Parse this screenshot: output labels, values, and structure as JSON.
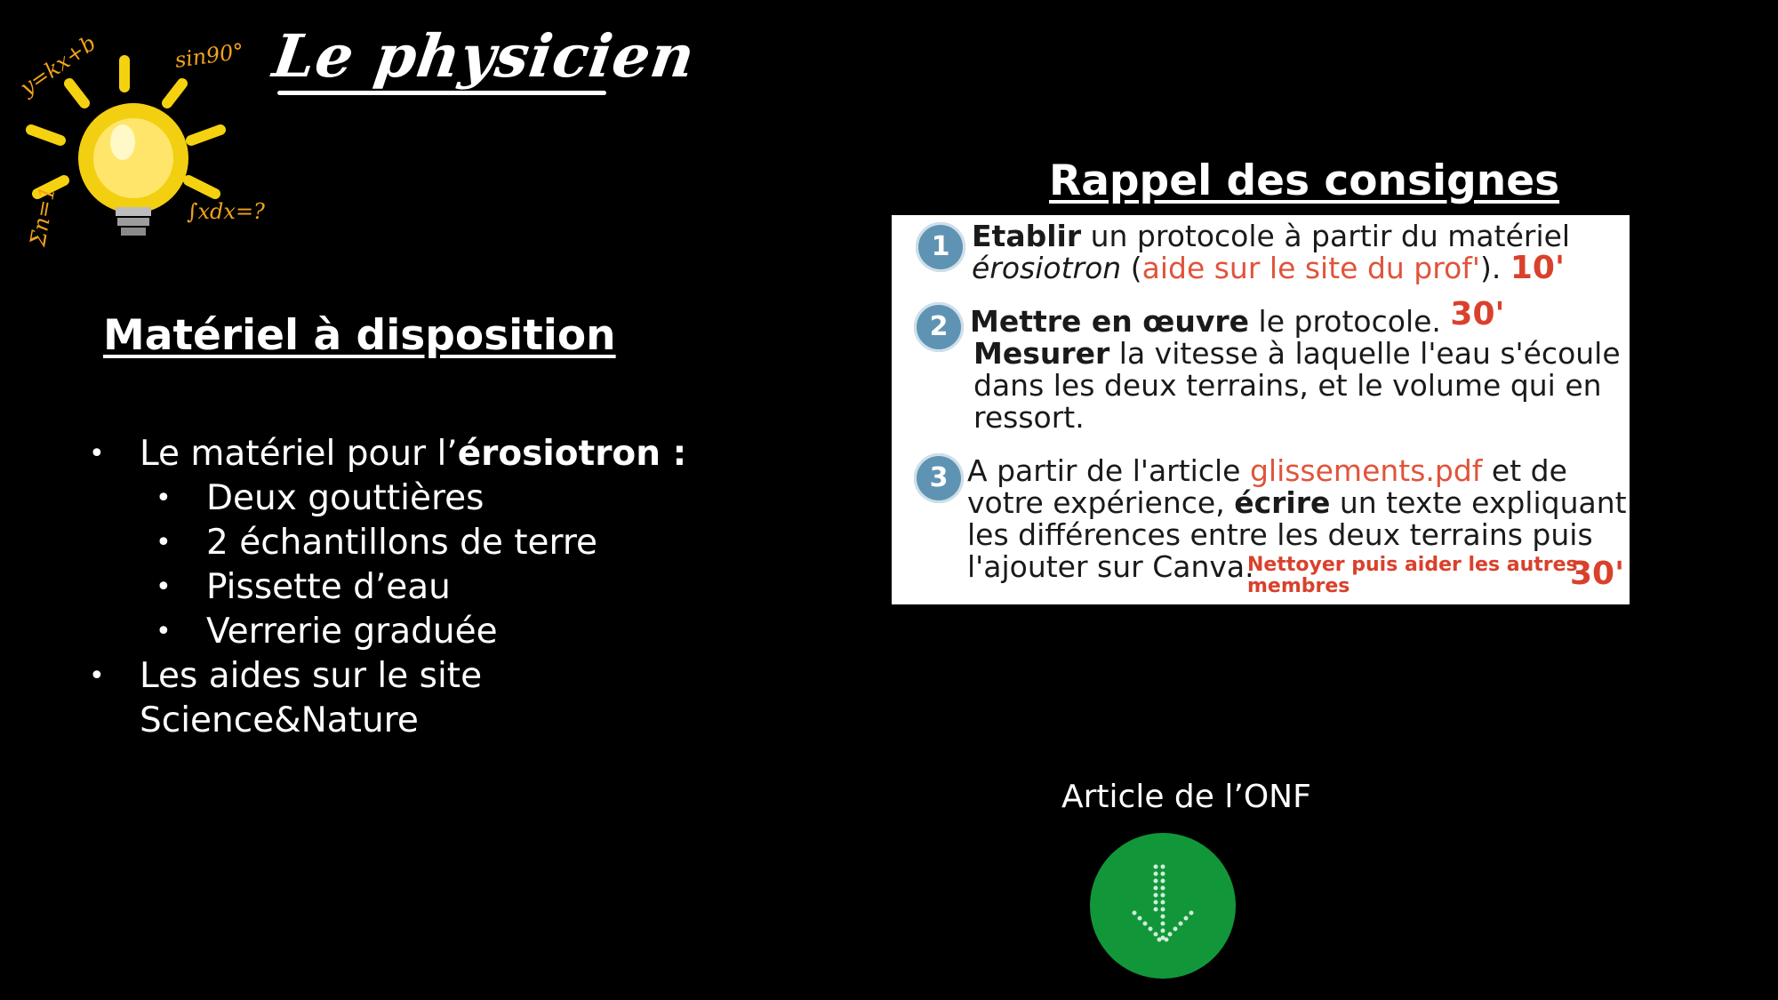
{
  "brand": {
    "title": "Le physicien",
    "logo_text": [
      "y=kx+b",
      "sin90°",
      "∫xdx=?",
      "Σ n=1 n"
    ]
  },
  "materiel": {
    "title": "Matériel à disposition",
    "item1_prefix": "Le matériel pour l’",
    "item1_bold": "érosiotron :",
    "sub_items": [
      "Deux gouttières",
      "2 échantillons de terre",
      "Pissette d’eau",
      "Verrerie graduée"
    ],
    "item2_line1": "Les aides sur le site",
    "item2_line2": "Science&Nature"
  },
  "consignes": {
    "title": "Rappel des consignes",
    "step1": {
      "num": "1",
      "bold": "Etablir",
      "text1": " un protocole à partir du matériel",
      "italic": "érosiotron",
      "paren_open": " (",
      "link": "aide sur le site du prof'",
      "paren_close": "). ",
      "duration": "10'"
    },
    "step2": {
      "num": "2",
      "bold": "Mettre en œuvre",
      "text1": " le protocole. ",
      "duration": "30'",
      "bold2": "Mesurer",
      "text2": " la vitesse à laquelle l'eau s'écoule",
      "text3": "dans les deux terrains, et le volume qui en",
      "text4": "ressort."
    },
    "step3": {
      "num": "3",
      "text1": "A  partir de l'article ",
      "link": "glissements.pdf",
      "text2": " et de",
      "text3": "votre expérience, ",
      "bold": "écrire",
      "text4": " un texte expliquant",
      "text5": "les différences entre les deux terrains puis",
      "text6": "l'ajouter sur Canva.",
      "note1": "Nettoyer puis aider les autres",
      "note2": "membres",
      "duration": "30'"
    }
  },
  "article": {
    "label": "Article de l’ONF",
    "icon": "download-arrow-icon"
  },
  "colors": {
    "background": "#000000",
    "accent_red": "#d9412c",
    "step_blue": "#5f93b3",
    "button_green": "#12963a"
  }
}
